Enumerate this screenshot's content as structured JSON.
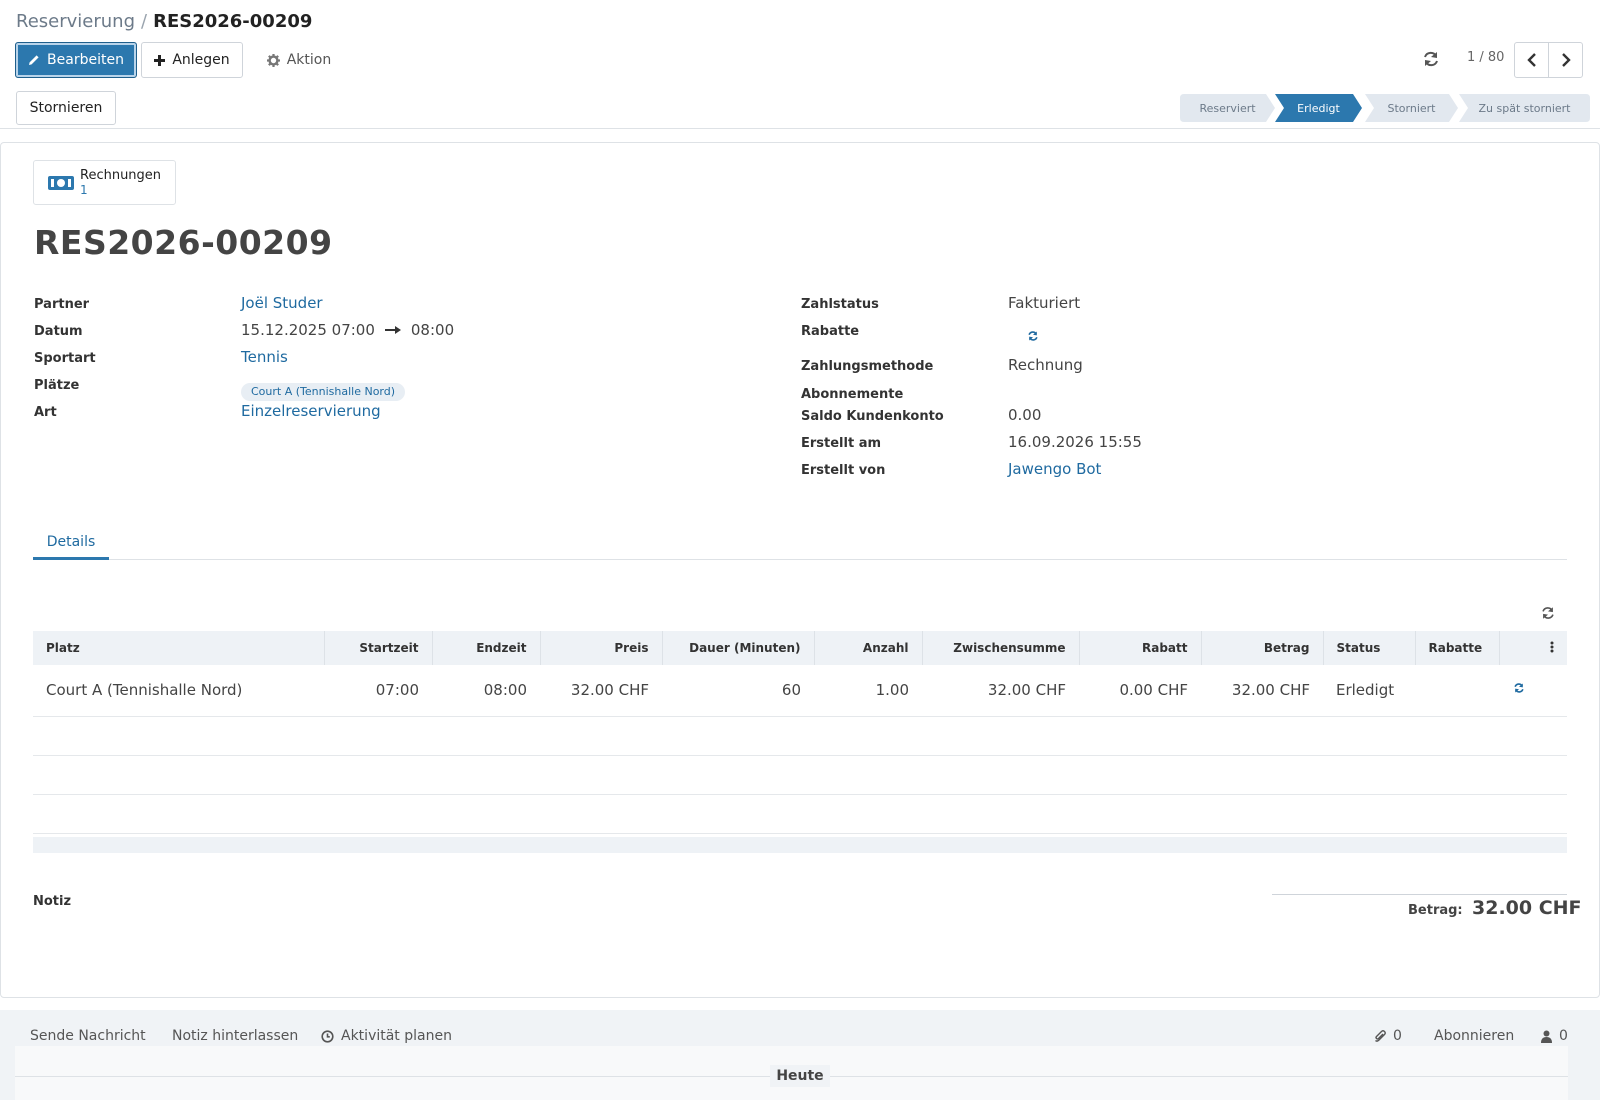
{
  "breadcrumb": {
    "parent": "Reservierung",
    "separator": "/",
    "current": "RES2026-00209"
  },
  "toolbar": {
    "edit_label": "Bearbeiten",
    "create_label": "Anlegen",
    "action_label": "Aktion",
    "cancel_label": "Stornieren"
  },
  "pager": {
    "value": "1 / 80"
  },
  "statusbar": {
    "stages": [
      {
        "label": "Reserviert",
        "active": false
      },
      {
        "label": "Erledigt",
        "active": true
      },
      {
        "label": "Storniert",
        "active": false
      },
      {
        "label": "Zu spät storniert",
        "active": false
      }
    ]
  },
  "smart_button": {
    "label": "Rechnungen",
    "count": "1"
  },
  "record": {
    "title": "RES2026-00209"
  },
  "left_fields": {
    "partner_label": "Partner",
    "partner_value": "Joël Studer",
    "date_label": "Datum",
    "date_start": "15.12.2025 07:00",
    "date_end": "08:00",
    "sport_label": "Sportart",
    "sport_value": "Tennis",
    "courts_label": "Plätze",
    "court_tag": "Court A (Tennishalle Nord)",
    "type_label": "Art",
    "type_value": "Einzelreservierung"
  },
  "right_fields": {
    "paystatus_label": "Zahlstatus",
    "paystatus_value": "Fakturiert",
    "discounts_label": "Rabatte",
    "paymethod_label": "Zahlungsmethode",
    "paymethod_value": "Rechnung",
    "subscriptions_label": "Abonnemente",
    "balance_label": "Saldo Kundenkonto",
    "balance_value": "0.00",
    "created_label": "Erstellt am",
    "created_value": "16.09.2026 15:55",
    "creator_label": "Erstellt von",
    "creator_value": "Jawengo Bot"
  },
  "tabs": [
    {
      "label": "Details"
    }
  ],
  "table": {
    "headers": [
      "Platz",
      "Startzeit",
      "Endzeit",
      "Preis",
      "Dauer (Minuten)",
      "Anzahl",
      "Zwischensumme",
      "Rabatt",
      "Betrag",
      "Status",
      "Rabatte"
    ],
    "rows": [
      [
        "Court A (Tennishalle Nord)",
        "07:00",
        "08:00",
        "32.00 CHF",
        "60",
        "1.00",
        "32.00 CHF",
        "0.00 CHF",
        "32.00 CHF",
        "Erledigt",
        ""
      ]
    ]
  },
  "notes": {
    "label": "Notiz"
  },
  "total": {
    "label": "Betrag:",
    "value": "32.00 CHF"
  },
  "chatter": {
    "send_message": "Sende Nachricht",
    "log_note": "Notiz hinterlassen",
    "schedule_activity": "Aktivität planen",
    "attachments_count": "0",
    "follow_label": "Abonnieren",
    "followers_count": "0",
    "today_label": "Heute"
  },
  "colors": {
    "primary": "#2c78ae",
    "link": "#1f6aa0",
    "stage_inactive": "#e2e8ef",
    "table_header": "#eef2f6"
  }
}
